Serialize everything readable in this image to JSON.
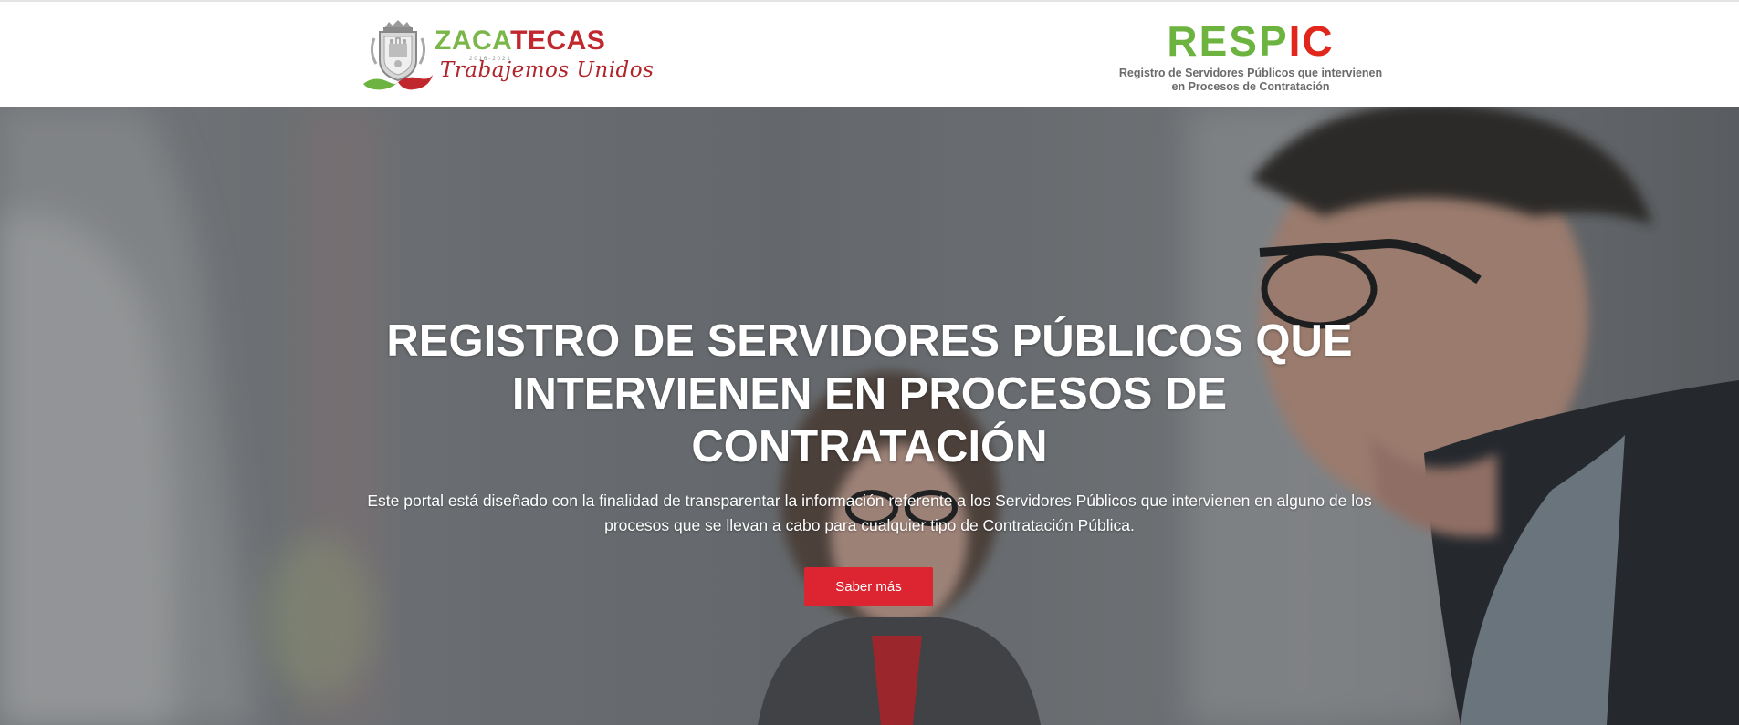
{
  "header": {
    "zacatecas_logo": {
      "word_part1": "ZACA",
      "word_part2": "TECAS",
      "tiny_text": "2016-2021",
      "slogan": "Trabajemos Unidos"
    },
    "respic_logo": {
      "word_part1": "RESP",
      "word_part2": "IC",
      "subtitle_line1": "Registro de Servidores Públicos que intervienen",
      "subtitle_line2": "en Procesos de Contratación"
    }
  },
  "hero": {
    "title": "REGISTRO DE SERVIDORES PÚBLICOS QUE INTERVIENEN EN PROCESOS DE CONTRATACIÓN",
    "description": "Este portal está diseñado con la finalidad de transparentar la información referente a los Servidores Públicos que intervienen en alguno de los procesos que se llevan a cabo para cualquier tipo de Contratación Pública.",
    "button_label": "Saber más"
  },
  "colors": {
    "brand_green": "#6cb33f",
    "brand_red": "#e1261c",
    "button_red": "#dc2530",
    "slogan_red": "#b0242b"
  },
  "icons": {
    "zacatecas_seal": "coat-of-arms-icon"
  }
}
